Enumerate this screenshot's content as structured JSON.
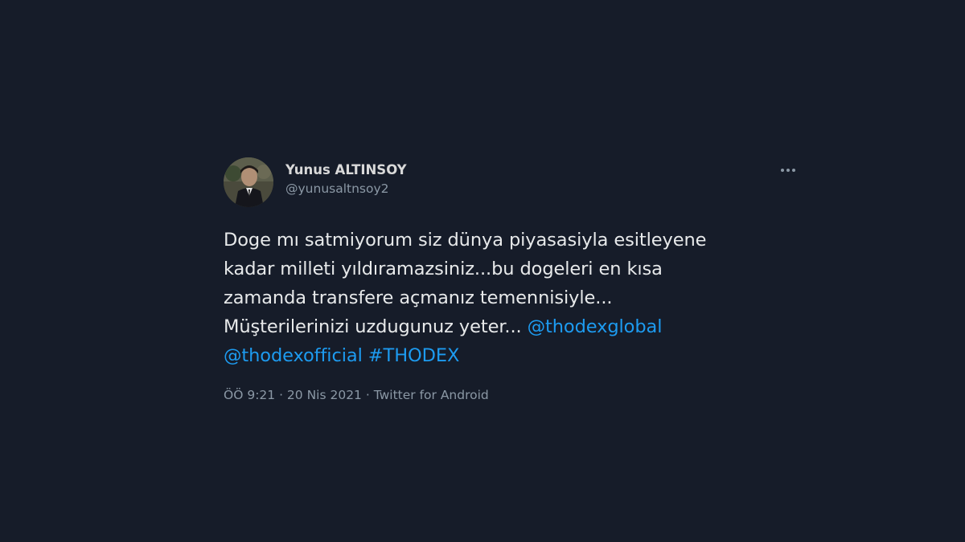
{
  "tweet": {
    "author": {
      "display_name": "Yunus ALTINSOY",
      "handle": "@yunusaltnsoy2"
    },
    "more_icon": "more-horizontal-icon",
    "text": {
      "line1": "Doge mı satmiyorum siz dünya piyasasiyla esitleyene",
      "line2": "kadar milleti yıldıramazsiniz...bu dogeleri en kısa",
      "line3": "zamanda transfere açmanız temennisiyle...",
      "line4_text": "Müşterilerinizi uzdugunuz yeter... ",
      "mention1": "@thodexglobal",
      "mention2": "@thodexofficial",
      "hashtag": "#THODEX"
    },
    "meta": {
      "time": "ÖÖ 9:21",
      "separator1": " · ",
      "date": "20 Nis 2021",
      "separator2": " · ",
      "source": "Twitter for Android"
    }
  },
  "colors": {
    "background": "#161c29",
    "text": "#e7e9ea",
    "secondary": "#8b98a5",
    "link": "#1d9bf0"
  }
}
